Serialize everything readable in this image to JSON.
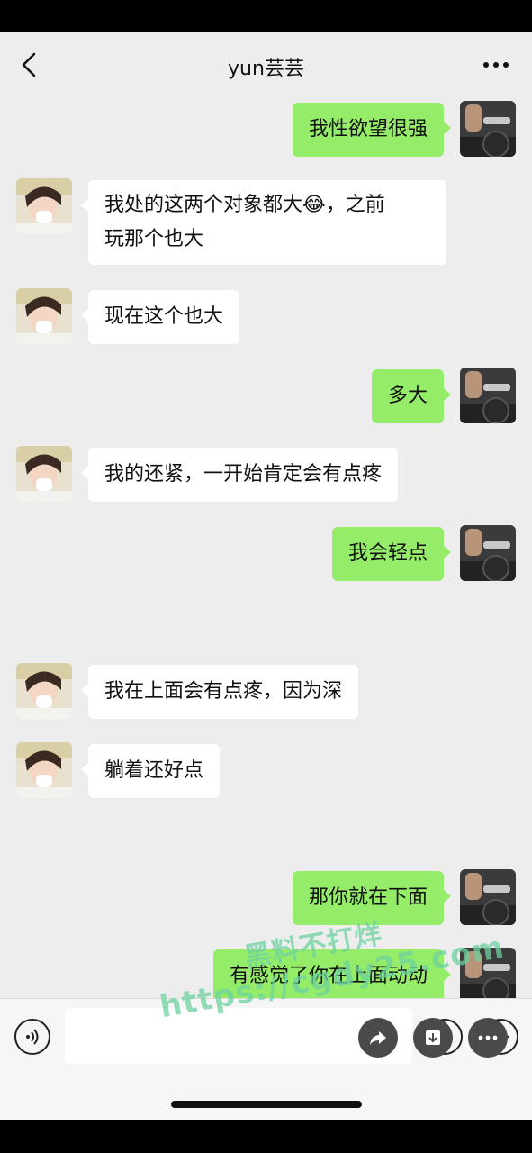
{
  "header": {
    "title": "yun芸芸"
  },
  "messages": [
    {
      "side": "right",
      "text": "我性欲望很强"
    },
    {
      "side": "left",
      "line1": "我处的这两个对象都大",
      "emoji": "😂",
      "line1_end": "，之前",
      "line2": "玩那个也大"
    },
    {
      "side": "left",
      "text": "现在这个也大"
    },
    {
      "side": "right",
      "text": "多大"
    },
    {
      "side": "left",
      "text": "我的还紧，一开始肯定会有点疼"
    },
    {
      "side": "right",
      "text": "我会轻点"
    },
    {
      "side": "left",
      "text": "我在上面会有点疼，因为深"
    },
    {
      "side": "left",
      "text": "躺着还好点"
    },
    {
      "side": "right",
      "text": "那你就在下面"
    },
    {
      "side": "right",
      "text": "有感觉了你在上面动动"
    }
  ],
  "watermark": {
    "line1": "黑料不打烊",
    "line2": "https://cgdy25.com"
  },
  "colors": {
    "sent_bubble": "#95ec69",
    "received_bubble": "#ffffff",
    "background": "#ededed"
  }
}
